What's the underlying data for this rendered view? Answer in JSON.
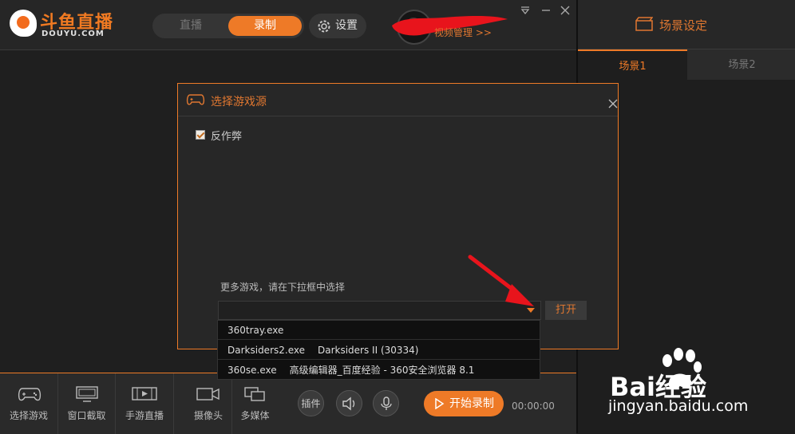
{
  "app": {
    "logo_title": "斗鱼直播",
    "logo_sub": "DOUYU.COM"
  },
  "topbar": {
    "tab_live": "直播",
    "tab_record": "录制",
    "settings_label": "设置",
    "video_manage": "视频管理 >>"
  },
  "scene": {
    "title": "场景设定",
    "tabs": [
      "场景1",
      "场景2"
    ]
  },
  "dialog": {
    "title": "选择游戏源",
    "anti_cheat_label": "反作弊",
    "anti_cheat_checked": true,
    "more_hint": "更多游戏，请在下拉框中选择",
    "select_value": "",
    "open_label": "打开",
    "options": [
      {
        "exe": "360tray.exe",
        "title": ""
      },
      {
        "exe": "Darksiders2.exe",
        "title": "Darksiders II (30334)"
      },
      {
        "exe": "360se.exe",
        "title": "高级编辑器_百度经验 - 360安全浏览器 8.1"
      }
    ]
  },
  "bottombar": {
    "tools": [
      "选择游戏",
      "窗口截取",
      "手游直播",
      "摄像头",
      "多媒体"
    ],
    "plugin_label": "插件",
    "start_record_label": "开始录制",
    "timer": "00:00:00"
  },
  "watermark": {
    "brand": "Bai经验",
    "url": "jingyan.baidu.com"
  },
  "colors": {
    "accent": "#ee7a27",
    "background": "#1d1d1d",
    "annotation": "#e8141c"
  }
}
